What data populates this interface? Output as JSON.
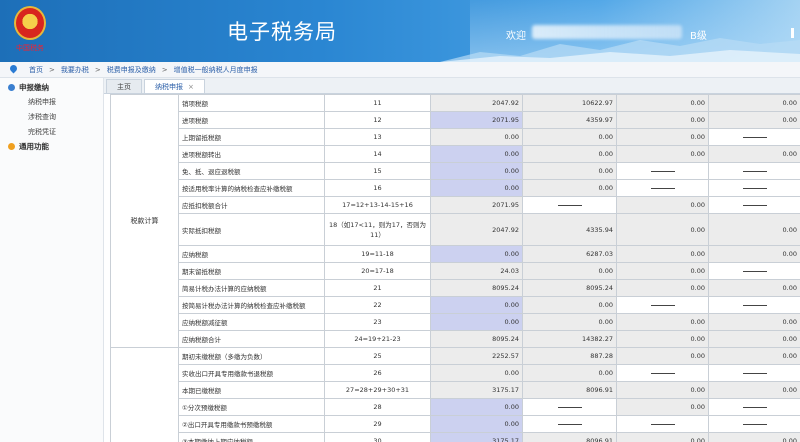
{
  "header": {
    "emblem_caption": "中国税务",
    "title": "电子税务局",
    "welcome": "欢迎",
    "level": "B级"
  },
  "breadcrumb": [
    "首页",
    "我要办税",
    "税费申报及缴纳",
    "增值税一般纳税人月度申报"
  ],
  "sidebar": {
    "group1": "申报缴纳",
    "items": [
      "纳税申报",
      "涉税查询",
      "完税凭证"
    ],
    "group2": "通用功能"
  },
  "tabs": [
    {
      "label": "主页"
    },
    {
      "label": "纳税申报",
      "close": "×"
    }
  ],
  "table": {
    "group_label": "税款计算",
    "rows": [
      {
        "name": "销项税额",
        "line": "11",
        "c1": "2047.92",
        "c2": "10622.97",
        "c3": "0.00",
        "c4": "0.00",
        "s1": "gray",
        "s2": "gray",
        "s3": "gray",
        "s4": "gray"
      },
      {
        "name": "进项税额",
        "line": "12",
        "c1": "2071.95",
        "c2": "4359.97",
        "c3": "0.00",
        "c4": "0.00",
        "s1": "blue",
        "s2": "gray",
        "s3": "gray",
        "s4": "gray"
      },
      {
        "name": "上期留抵税额",
        "line": "13",
        "c1": "0.00",
        "c2": "0.00",
        "c3": "0.00",
        "c4": "—",
        "s1": "gray",
        "s2": "gray",
        "s3": "gray",
        "s4": "white"
      },
      {
        "name": "进项税额转出",
        "line": "14",
        "c1": "0.00",
        "c2": "0.00",
        "c3": "0.00",
        "c4": "0.00",
        "s1": "blue",
        "s2": "gray",
        "s3": "gray",
        "s4": "gray"
      },
      {
        "name": "免、抵、退应退税额",
        "line": "15",
        "c1": "0.00",
        "c2": "0.00",
        "c3": "—",
        "c4": "—",
        "s1": "blue",
        "s2": "gray",
        "s3": "white",
        "s4": "white"
      },
      {
        "name": "按适用税率计算的纳税检查应补缴税额",
        "line": "16",
        "c1": "0.00",
        "c2": "0.00",
        "c3": "—",
        "c4": "—",
        "s1": "blue",
        "s2": "gray",
        "s3": "white",
        "s4": "white"
      },
      {
        "name": "应抵扣税额合计",
        "line": "17=12+13-14-15+16",
        "c1": "2071.95",
        "c2": "—",
        "c3": "0.00",
        "c4": "—",
        "s1": "gray",
        "s2": "white",
        "s3": "gray",
        "s4": "white"
      },
      {
        "name": "实际抵扣税额",
        "line": "18（如17<11，则为17，否则为11）",
        "c1": "2047.92",
        "c2": "4335.94",
        "c3": "0.00",
        "c4": "0.00",
        "s1": "gray",
        "s2": "gray",
        "s3": "gray",
        "s4": "gray",
        "tall": true
      },
      {
        "name": "应纳税额",
        "line": "19=11-18",
        "c1": "0.00",
        "c2": "6287.03",
        "c3": "0.00",
        "c4": "0.00",
        "s1": "blue",
        "s2": "gray",
        "s3": "gray",
        "s4": "gray"
      },
      {
        "name": "期末留抵税额",
        "line": "20=17-18",
        "c1": "24.03",
        "c2": "0.00",
        "c3": "0.00",
        "c4": "—",
        "s1": "gray",
        "s2": "gray",
        "s3": "gray",
        "s4": "white"
      },
      {
        "name": "简易计税办法计算的应纳税额",
        "line": "21",
        "c1": "8095.24",
        "c2": "8095.24",
        "c3": "0.00",
        "c4": "0.00",
        "s1": "gray",
        "s2": "gray",
        "s3": "gray",
        "s4": "gray"
      },
      {
        "name": "按简易计税办法计算的纳税检查应补缴税额",
        "line": "22",
        "c1": "0.00",
        "c2": "0.00",
        "c3": "—",
        "c4": "—",
        "s1": "blue",
        "s2": "gray",
        "s3": "white",
        "s4": "white"
      },
      {
        "name": "应纳税额减征额",
        "line": "23",
        "c1": "0.00",
        "c2": "0.00",
        "c3": "0.00",
        "c4": "0.00",
        "s1": "blue",
        "s2": "gray",
        "s3": "gray",
        "s4": "gray"
      },
      {
        "name": "应纳税额合计",
        "line": "24=19+21-23",
        "c1": "8095.24",
        "c2": "14382.27",
        "c3": "0.00",
        "c4": "0.00",
        "s1": "gray",
        "s2": "gray",
        "s3": "gray",
        "s4": "gray"
      },
      {
        "name": "期初未缴税额（多缴为负数）",
        "line": "25",
        "c1": "2252.57",
        "c2": "887.28",
        "c3": "0.00",
        "c4": "0.00",
        "s1": "gray",
        "s2": "gray",
        "s3": "gray",
        "s4": "gray"
      },
      {
        "name": "实收出口开具专用缴款书退税额",
        "line": "26",
        "c1": "0.00",
        "c2": "0.00",
        "c3": "—",
        "c4": "—",
        "s1": "gray",
        "s2": "gray",
        "s3": "white",
        "s4": "white"
      },
      {
        "name": "本期已缴税额",
        "line": "27=28+29+30+31",
        "c1": "3175.17",
        "c2": "8096.91",
        "c3": "0.00",
        "c4": "0.00",
        "s1": "gray",
        "s2": "gray",
        "s3": "gray",
        "s4": "gray"
      },
      {
        "name": "①分次预缴税额",
        "line": "28",
        "c1": "0.00",
        "c2": "—",
        "c3": "0.00",
        "c4": "—",
        "s1": "blue",
        "s2": "white",
        "s3": "gray",
        "s4": "white"
      },
      {
        "name": "②出口开具专用缴款书预缴税额",
        "line": "29",
        "c1": "0.00",
        "c2": "—",
        "c3": "—",
        "c4": "—",
        "s1": "blue",
        "s2": "white",
        "s3": "white",
        "s4": "white"
      },
      {
        "name": "③本期缴纳上期应纳税额",
        "line": "30",
        "c1": "3175.17",
        "c2": "8096.91",
        "c3": "0.00",
        "c4": "0.00",
        "s1": "blue",
        "s2": "gray",
        "s3": "gray",
        "s4": "gray"
      }
    ]
  }
}
